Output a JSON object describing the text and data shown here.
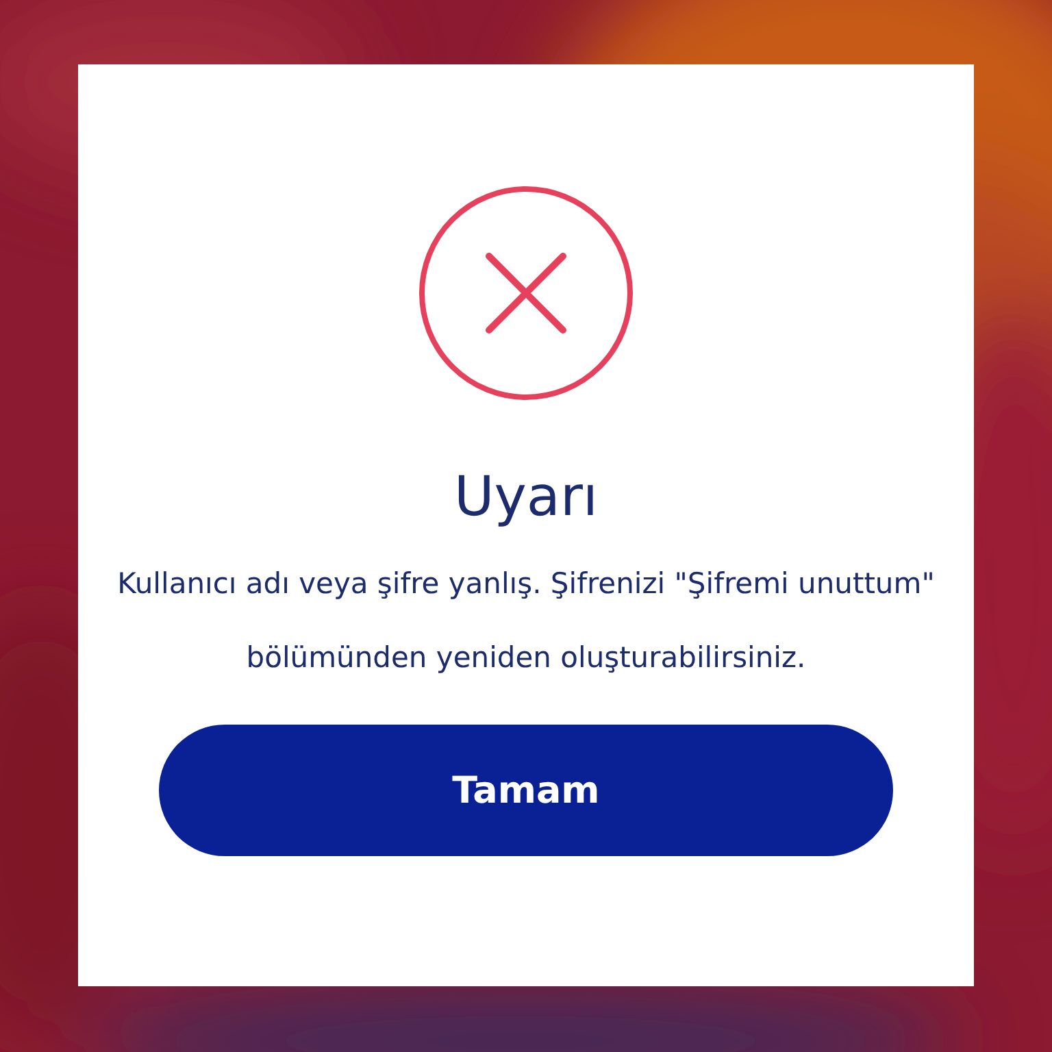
{
  "dialog": {
    "title": "Uyarı",
    "message": "Kullanıcı adı veya şifre yanlış. Şifrenizi \"Şifremi unuttum\" bölümünden yeniden oluşturabilirsiniz.",
    "button": "Tamam"
  }
}
